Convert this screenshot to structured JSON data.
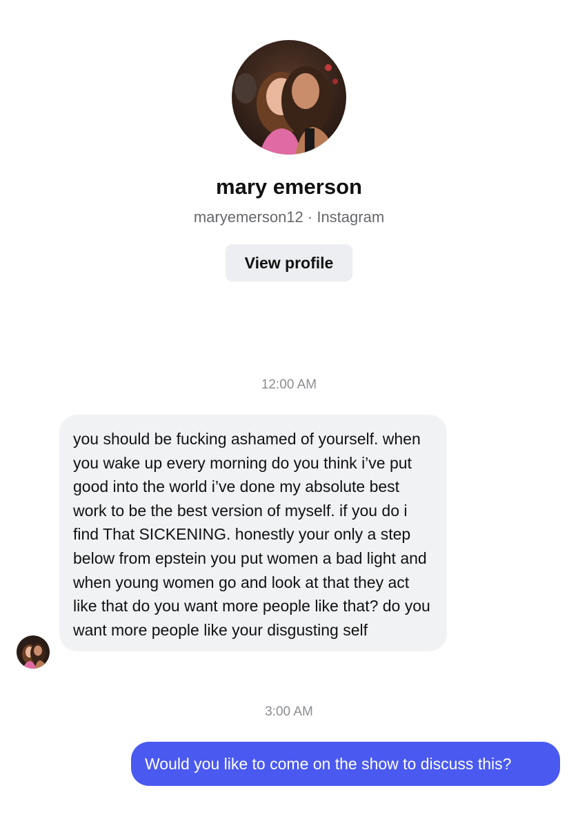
{
  "profile": {
    "display_name": "mary emerson",
    "subline": "maryemerson12 · Instagram",
    "view_profile_label": "View profile"
  },
  "conversation": {
    "messages": [
      {
        "timestamp": "12:00 AM",
        "direction": "incoming",
        "text": "you should be fucking ashamed of yourself. when you wake up every morning do you think i’ve put good into the world i’ve done my absolute best work to be the best version of myself. if you do i find That SICKENING. honestly your only a step below from epstein you put women a bad light and when young women go and look at that they act like that do you want more people like that? do you want more people like your disgusting self"
      },
      {
        "timestamp": "3:00 AM",
        "direction": "outgoing",
        "text": "Would you like to come on the show to discuss this?"
      }
    ]
  },
  "colors": {
    "incoming_bubble": "#f1f2f4",
    "outgoing_bubble": "#4a59ef",
    "timestamp_text": "#8a8d91",
    "subline_text": "#65676b",
    "button_bg": "#eceef1"
  },
  "icons": {
    "profile_photo": "profile-avatar",
    "sender_photo": "sender-avatar"
  }
}
